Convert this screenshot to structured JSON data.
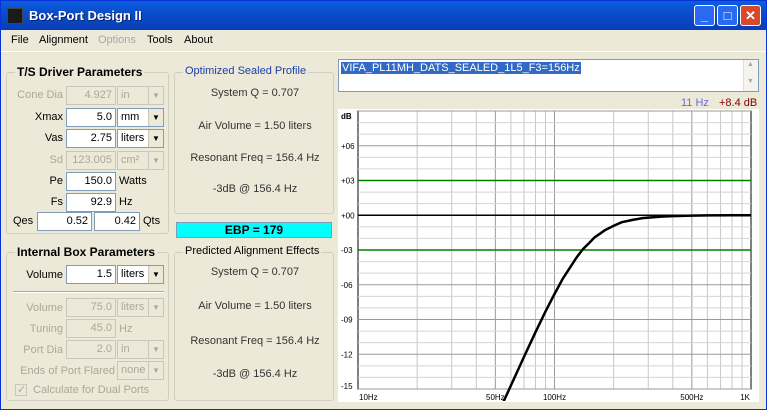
{
  "window": {
    "title": "Box-Port Design II"
  },
  "menu": [
    {
      "label": "File",
      "disabled": false
    },
    {
      "label": "Alignment",
      "disabled": false
    },
    {
      "label": "Options",
      "disabled": true
    },
    {
      "label": "Tools",
      "disabled": false
    },
    {
      "label": "About",
      "disabled": false
    }
  ],
  "ts": {
    "title": "T/S Driver Parameters",
    "cone_dia": {
      "label": "Cone Dia",
      "value": "4.927",
      "unit": "in"
    },
    "xmax": {
      "label": "Xmax",
      "value": "5.0",
      "unit": "mm"
    },
    "vas": {
      "label": "Vas",
      "value": "2.75",
      "unit": "liters"
    },
    "sd": {
      "label": "Sd",
      "value": "123.005",
      "unit": "cm²"
    },
    "pe": {
      "label": "Pe",
      "value": "150.0",
      "unit": "Watts"
    },
    "fs": {
      "label": "Fs",
      "value": "92.9",
      "unit": "Hz"
    },
    "qes": {
      "label": "Qes",
      "value": "0.52"
    },
    "qts": {
      "label": "Qts",
      "value": "0.42"
    }
  },
  "box": {
    "title": "Internal Box Parameters",
    "volume": {
      "label": "Volume",
      "value": "1.5",
      "unit": "liters"
    },
    "volume2": {
      "label": "Volume",
      "value": "75.0",
      "unit": "liters"
    },
    "tuning": {
      "label": "Tuning",
      "value": "45.0",
      "unit": "Hz"
    },
    "port_dia": {
      "label": "Port Dia",
      "value": "2.0",
      "unit": "in"
    },
    "ends": {
      "label": "Ends of Port Flared",
      "value": "none"
    },
    "dual": {
      "label": "Calculate for Dual Ports"
    }
  },
  "profile": {
    "title": "Optimized Sealed Profile",
    "lines": [
      "System Q = 0.707",
      "Air Volume = 1.50 liters",
      "Resonant Freq = 156.4 Hz",
      "-3dB @ 156.4 Hz"
    ]
  },
  "ebp": "EBP = 179",
  "effects": {
    "title": "Predicted Alignment Effects",
    "lines": [
      "System Q = 0.707",
      "Air Volume = 1.50 liters",
      "Resonant Freq = 156.4 Hz",
      "-3dB @ 156.4 Hz"
    ]
  },
  "design_title": "VIFA_PL11MH_DATS_SEALED_1L5_F3=156Hz",
  "readout": {
    "freq": "11 Hz",
    "db": "+8.4 dB"
  },
  "colors": {
    "accent": "#316ac5",
    "ebp_bg": "#00ffff",
    "grid_major_h": "#008000",
    "curve": "#000000",
    "db_readout": "#800000",
    "hz_readout": "#6a6adf"
  },
  "chart_data": {
    "type": "line",
    "title": "",
    "xlabel": "",
    "ylabel": "dB",
    "x_scale": "log",
    "xlim": [
      10,
      1000
    ],
    "ylim": [
      -15,
      9
    ],
    "x_tick_labels": [
      "10Hz",
      "50Hz",
      "100Hz",
      "500Hz",
      "1K"
    ],
    "x_ticks": [
      10,
      50,
      100,
      500,
      1000
    ],
    "y_tick_labels": [
      "+06",
      "+03",
      "+00",
      "-03",
      "-06",
      "-09",
      "-12",
      "-15"
    ],
    "y_ticks": [
      6,
      3,
      0,
      -3,
      -6,
      -9,
      -12,
      -15
    ],
    "green_lines": [
      3,
      -3
    ],
    "series": [
      {
        "x": [
          55,
          60,
          70,
          80,
          90,
          100,
          110,
          120,
          130,
          140,
          150,
          160,
          170,
          180,
          200,
          220,
          250,
          280,
          300,
          350,
          400,
          500,
          600,
          800,
          1000
        ],
        "y": [
          -16.1,
          -14.7,
          -12.2,
          -10.1,
          -8.3,
          -6.8,
          -5.5,
          -4.5,
          -3.6,
          -2.9,
          -2.4,
          -1.9,
          -1.6,
          -1.3,
          -0.9,
          -0.6,
          -0.4,
          -0.25,
          -0.2,
          -0.12,
          -0.07,
          -0.03,
          -0.01,
          0.0,
          0.0
        ]
      }
    ]
  }
}
